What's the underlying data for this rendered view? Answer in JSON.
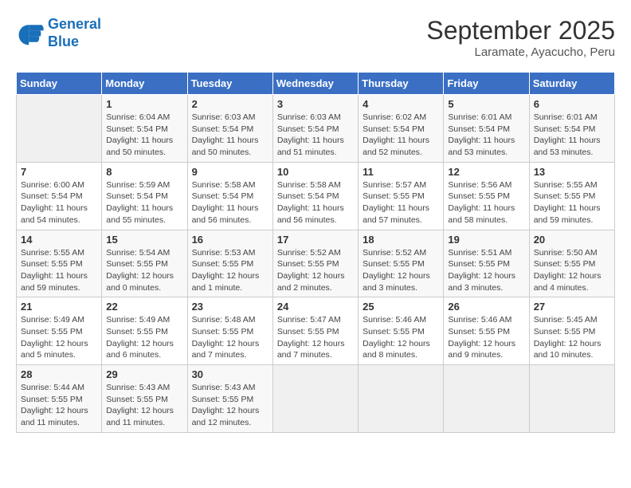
{
  "logo": {
    "line1": "General",
    "line2": "Blue"
  },
  "title": "September 2025",
  "subtitle": "Laramate, Ayacucho, Peru",
  "weekdays": [
    "Sunday",
    "Monday",
    "Tuesday",
    "Wednesday",
    "Thursday",
    "Friday",
    "Saturday"
  ],
  "weeks": [
    [
      {
        "day": "",
        "info": ""
      },
      {
        "day": "1",
        "info": "Sunrise: 6:04 AM\nSunset: 5:54 PM\nDaylight: 11 hours\nand 50 minutes."
      },
      {
        "day": "2",
        "info": "Sunrise: 6:03 AM\nSunset: 5:54 PM\nDaylight: 11 hours\nand 50 minutes."
      },
      {
        "day": "3",
        "info": "Sunrise: 6:03 AM\nSunset: 5:54 PM\nDaylight: 11 hours\nand 51 minutes."
      },
      {
        "day": "4",
        "info": "Sunrise: 6:02 AM\nSunset: 5:54 PM\nDaylight: 11 hours\nand 52 minutes."
      },
      {
        "day": "5",
        "info": "Sunrise: 6:01 AM\nSunset: 5:54 PM\nDaylight: 11 hours\nand 53 minutes."
      },
      {
        "day": "6",
        "info": "Sunrise: 6:01 AM\nSunset: 5:54 PM\nDaylight: 11 hours\nand 53 minutes."
      }
    ],
    [
      {
        "day": "7",
        "info": "Sunrise: 6:00 AM\nSunset: 5:54 PM\nDaylight: 11 hours\nand 54 minutes."
      },
      {
        "day": "8",
        "info": "Sunrise: 5:59 AM\nSunset: 5:54 PM\nDaylight: 11 hours\nand 55 minutes."
      },
      {
        "day": "9",
        "info": "Sunrise: 5:58 AM\nSunset: 5:54 PM\nDaylight: 11 hours\nand 56 minutes."
      },
      {
        "day": "10",
        "info": "Sunrise: 5:58 AM\nSunset: 5:54 PM\nDaylight: 11 hours\nand 56 minutes."
      },
      {
        "day": "11",
        "info": "Sunrise: 5:57 AM\nSunset: 5:55 PM\nDaylight: 11 hours\nand 57 minutes."
      },
      {
        "day": "12",
        "info": "Sunrise: 5:56 AM\nSunset: 5:55 PM\nDaylight: 11 hours\nand 58 minutes."
      },
      {
        "day": "13",
        "info": "Sunrise: 5:55 AM\nSunset: 5:55 PM\nDaylight: 11 hours\nand 59 minutes."
      }
    ],
    [
      {
        "day": "14",
        "info": "Sunrise: 5:55 AM\nSunset: 5:55 PM\nDaylight: 11 hours\nand 59 minutes."
      },
      {
        "day": "15",
        "info": "Sunrise: 5:54 AM\nSunset: 5:55 PM\nDaylight: 12 hours\nand 0 minutes."
      },
      {
        "day": "16",
        "info": "Sunrise: 5:53 AM\nSunset: 5:55 PM\nDaylight: 12 hours\nand 1 minute."
      },
      {
        "day": "17",
        "info": "Sunrise: 5:52 AM\nSunset: 5:55 PM\nDaylight: 12 hours\nand 2 minutes."
      },
      {
        "day": "18",
        "info": "Sunrise: 5:52 AM\nSunset: 5:55 PM\nDaylight: 12 hours\nand 3 minutes."
      },
      {
        "day": "19",
        "info": "Sunrise: 5:51 AM\nSunset: 5:55 PM\nDaylight: 12 hours\nand 3 minutes."
      },
      {
        "day": "20",
        "info": "Sunrise: 5:50 AM\nSunset: 5:55 PM\nDaylight: 12 hours\nand 4 minutes."
      }
    ],
    [
      {
        "day": "21",
        "info": "Sunrise: 5:49 AM\nSunset: 5:55 PM\nDaylight: 12 hours\nand 5 minutes."
      },
      {
        "day": "22",
        "info": "Sunrise: 5:49 AM\nSunset: 5:55 PM\nDaylight: 12 hours\nand 6 minutes."
      },
      {
        "day": "23",
        "info": "Sunrise: 5:48 AM\nSunset: 5:55 PM\nDaylight: 12 hours\nand 7 minutes."
      },
      {
        "day": "24",
        "info": "Sunrise: 5:47 AM\nSunset: 5:55 PM\nDaylight: 12 hours\nand 7 minutes."
      },
      {
        "day": "25",
        "info": "Sunrise: 5:46 AM\nSunset: 5:55 PM\nDaylight: 12 hours\nand 8 minutes."
      },
      {
        "day": "26",
        "info": "Sunrise: 5:46 AM\nSunset: 5:55 PM\nDaylight: 12 hours\nand 9 minutes."
      },
      {
        "day": "27",
        "info": "Sunrise: 5:45 AM\nSunset: 5:55 PM\nDaylight: 12 hours\nand 10 minutes."
      }
    ],
    [
      {
        "day": "28",
        "info": "Sunrise: 5:44 AM\nSunset: 5:55 PM\nDaylight: 12 hours\nand 11 minutes."
      },
      {
        "day": "29",
        "info": "Sunrise: 5:43 AM\nSunset: 5:55 PM\nDaylight: 12 hours\nand 11 minutes."
      },
      {
        "day": "30",
        "info": "Sunrise: 5:43 AM\nSunset: 5:55 PM\nDaylight: 12 hours\nand 12 minutes."
      },
      {
        "day": "",
        "info": ""
      },
      {
        "day": "",
        "info": ""
      },
      {
        "day": "",
        "info": ""
      },
      {
        "day": "",
        "info": ""
      }
    ]
  ]
}
